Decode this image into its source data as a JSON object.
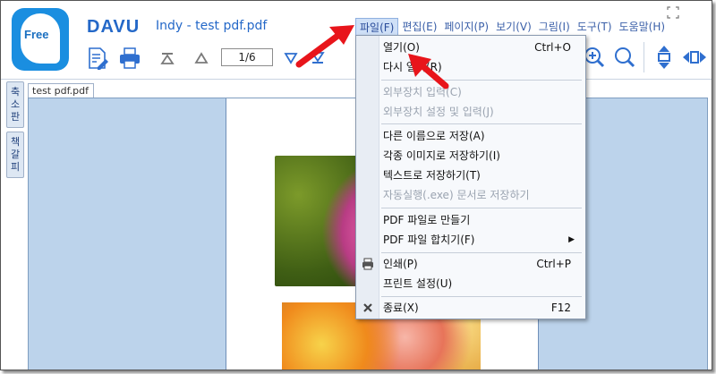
{
  "app": {
    "logo_text": "Free",
    "brand": "DAVU",
    "title": "Indy - test pdf.pdf"
  },
  "menubar": [
    {
      "label": "파일(F)",
      "name": "menu-file",
      "active": true
    },
    {
      "label": "편집(E)",
      "name": "menu-edit"
    },
    {
      "label": "페이지(P)",
      "name": "menu-page"
    },
    {
      "label": "보기(V)",
      "name": "menu-view"
    },
    {
      "label": "그림(I)",
      "name": "menu-image"
    },
    {
      "label": "도구(T)",
      "name": "menu-tools"
    },
    {
      "label": "도움말(H)",
      "name": "menu-help"
    }
  ],
  "toolbar": {
    "page_indicator": "1/6"
  },
  "sidetabs": [
    {
      "label": "축소판",
      "name": "sidetab-thumbnail"
    },
    {
      "label": "책갈피",
      "name": "sidetab-bookmark"
    }
  ],
  "document": {
    "tab_label": "test pdf.pdf"
  },
  "file_menu": {
    "items": [
      {
        "label": "열기(O)",
        "shortcut": "Ctrl+O",
        "disabled": false
      },
      {
        "label": "다시 열기(R)",
        "shortcut": "",
        "disabled": false
      },
      {
        "label": "외부장치 입력(C)",
        "shortcut": "",
        "disabled": true
      },
      {
        "label": "외부장치 설정 및 입력(J)",
        "shortcut": "",
        "disabled": true
      },
      {
        "label": "다른 이름으로 저장(A)",
        "shortcut": "",
        "disabled": false
      },
      {
        "label": "각종 이미지로 저장하기(I)",
        "shortcut": "",
        "disabled": false
      },
      {
        "label": "텍스트로 저장하기(T)",
        "shortcut": "",
        "disabled": false
      },
      {
        "label": "자동실행(.exe) 문서로 저장하기",
        "shortcut": "",
        "disabled": true
      },
      {
        "label": "PDF 파일로 만들기",
        "shortcut": "",
        "disabled": false
      },
      {
        "label": "PDF 파일 합치기(F)",
        "shortcut": "",
        "disabled": false
      },
      {
        "label": "인쇄(P)",
        "shortcut": "Ctrl+P",
        "disabled": false
      },
      {
        "label": "프린트 설정(U)",
        "shortcut": "",
        "disabled": false
      },
      {
        "label": "종료(X)",
        "shortcut": "F12",
        "disabled": false
      }
    ]
  },
  "colors": {
    "brand_blue": "#2468c8",
    "menu_highlight": "#cfe0f7",
    "annotation_arrow": "#e8151b"
  }
}
